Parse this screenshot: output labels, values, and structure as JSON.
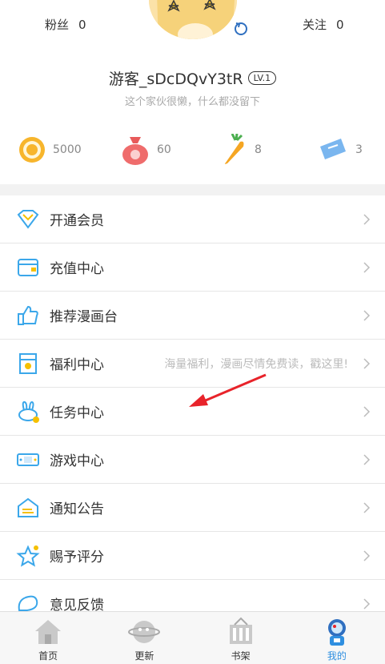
{
  "profile": {
    "fans_label": "粉丝",
    "fans_count": "0",
    "follow_label": "关注",
    "follow_count": "0",
    "username": "游客_sDcDQvY3tR",
    "level": "LV.1",
    "signature": "这个家伙很懒，什么都没留下"
  },
  "assets": [
    {
      "icon": "coin-icon",
      "value": "5000"
    },
    {
      "icon": "money-bag-icon",
      "value": "60"
    },
    {
      "icon": "carrot-icon",
      "value": "8"
    },
    {
      "icon": "ticket-icon",
      "value": "3"
    }
  ],
  "menu": [
    {
      "label": "开通会员",
      "hint": "",
      "icon": "diamond-icon"
    },
    {
      "label": "充值中心",
      "hint": "",
      "icon": "wallet-icon"
    },
    {
      "label": "推荐漫画台",
      "hint": "",
      "icon": "thumbs-up-icon"
    },
    {
      "label": "福利中心",
      "hint": "海量福利，漫画尽情免费读，戳这里!",
      "icon": "gift-envelope-icon"
    },
    {
      "label": "任务中心",
      "hint": "",
      "icon": "bunny-icon"
    },
    {
      "label": "游戏中心",
      "hint": "",
      "icon": "game-icon"
    },
    {
      "label": "通知公告",
      "hint": "",
      "icon": "notice-icon"
    },
    {
      "label": "赐予评分",
      "hint": "",
      "icon": "star-icon"
    },
    {
      "label": "意见反馈",
      "hint": "",
      "icon": "feedback-icon"
    }
  ],
  "tabs": [
    {
      "label": "首页",
      "icon": "home-icon"
    },
    {
      "label": "更新",
      "icon": "planet-icon"
    },
    {
      "label": "书架",
      "icon": "bookshelf-icon"
    },
    {
      "label": "我的",
      "icon": "astronaut-icon"
    }
  ],
  "colors": {
    "accent": "#2f8fe0",
    "divider": "#e6e6e6",
    "hint": "#bbbbbb",
    "arrow": "#e8232a"
  }
}
